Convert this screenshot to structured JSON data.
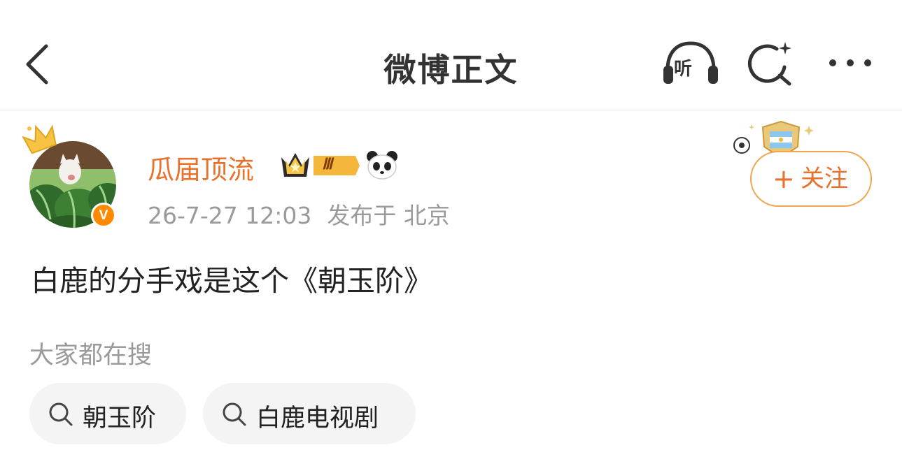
{
  "header": {
    "title": "微博正文",
    "listen_label": "听"
  },
  "author": {
    "name": "瓜届顶流",
    "vip_level": "Ⅲ",
    "time": "26-7-27 12:03",
    "location": "发布于 北京",
    "verified_mark": "V"
  },
  "follow_button": {
    "plus": "+",
    "label": "关注"
  },
  "post": {
    "text": "白鹿的分手戏是这个《朝玉阶》"
  },
  "searches": {
    "heading": "大家都在搜",
    "items": [
      "朝玉阶",
      "白鹿电视剧"
    ]
  },
  "colors": {
    "accent_orange": "#e8722c",
    "follow_border": "#f0a44e",
    "muted_text": "#9a9a9a",
    "chip_bg": "#f4f4f4"
  },
  "icons": [
    "back-arrow-icon",
    "headphones-icon",
    "ai-search-icon",
    "more-dots-icon",
    "search-icon",
    "crown-icon",
    "panda-icon",
    "medal-icon"
  ]
}
